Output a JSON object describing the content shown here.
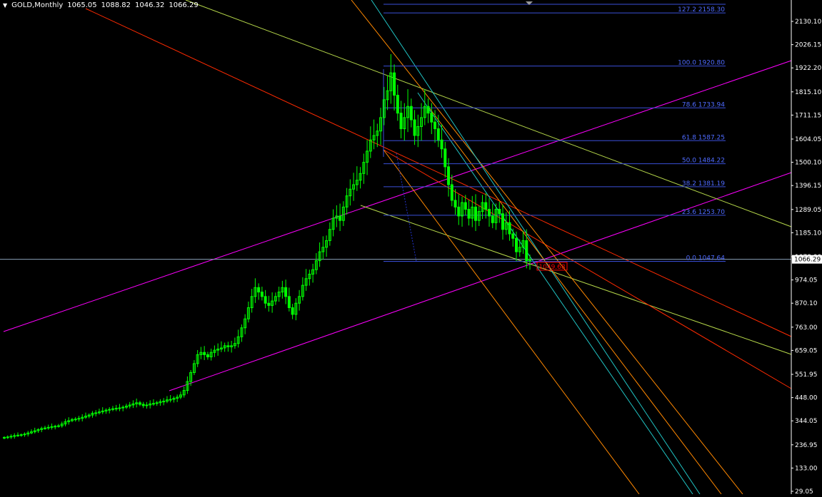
{
  "header": {
    "symbol_timeframe": "GOLD,Monthly",
    "open": "1065.05",
    "high": "1088.82",
    "low": "1046.32",
    "close": "1066.29",
    "menu_icon": "triangle-down-icon"
  },
  "colors": {
    "background": "#000000",
    "candle": "#00ff00",
    "axis_text": "#ffffff",
    "fib_line": "#3a4fd8",
    "fib_text": "#4f6bff",
    "price_label_bg": "#ffffff",
    "magenta": "#ff00ff",
    "red": "#ff2a00",
    "orange": "#ff8800",
    "yellow_green": "#b7d94a",
    "cyan": "#20c4c4",
    "crosshair": "#8aa0b8",
    "price_marker": "#ff0000"
  },
  "chart_data": {
    "type": "candlestick",
    "instrument": "GOLD",
    "timeframe": "Monthly",
    "y_axis_ticks": [
      "2130.10",
      "2026.15",
      "1922.20",
      "1815.10",
      "1711.15",
      "1604.05",
      "1500.10",
      "1396.15",
      "1289.05",
      "1185.10",
      "1078.00",
      "974.05",
      "870.10",
      "763.00",
      "659.05",
      "551.95",
      "448.00",
      "344.05",
      "236.95",
      "133.00",
      "29.05"
    ],
    "current_price_label": "1066.29",
    "ylim": [
      29.05,
      2130.1
    ],
    "fibonacci": [
      {
        "label": "127.2  2158.30",
        "level": 127.2,
        "price": 2158.3
      },
      {
        "label": "100.0  1920.80",
        "level": 100.0,
        "price": 1920.8
      },
      {
        "label": "78.6  1733.94",
        "level": 78.6,
        "price": 1733.94
      },
      {
        "label": "61.8  1587.25",
        "level": 61.8,
        "price": 1587.25
      },
      {
        "label": "50.0  1484.22",
        "level": 50.0,
        "price": 1484.22
      },
      {
        "label": "38.2  1381.19",
        "level": 38.2,
        "price": 1381.19
      },
      {
        "label": "23.6  1253.70",
        "level": 23.6,
        "price": 1253.7
      },
      {
        "label": "0.0  1047.64",
        "level": 0.0,
        "price": 1047.64
      }
    ],
    "price_marker_label": "1049.68",
    "price_series_close": [
      270,
      272,
      275,
      278,
      280,
      282,
      285,
      290,
      295,
      300,
      305,
      310,
      312,
      315,
      318,
      320,
      322,
      330,
      340,
      345,
      350,
      352,
      355,
      360,
      365,
      370,
      378,
      380,
      384,
      388,
      392,
      395,
      398,
      400,
      402,
      405,
      410,
      415,
      420,
      425,
      418,
      412,
      415,
      420,
      422,
      425,
      430,
      432,
      438,
      440,
      445,
      450,
      460,
      480,
      520,
      560,
      600,
      640,
      650,
      640,
      630,
      650,
      660,
      665,
      670,
      680,
      675,
      680,
      690,
      720,
      760,
      800,
      850,
      900,
      940,
      920,
      900,
      870,
      860,
      880,
      900,
      920,
      940,
      900,
      850,
      820,
      870,
      900,
      950,
      980,
      1000,
      1020,
      1060,
      1100,
      1120,
      1150,
      1200,
      1250,
      1260,
      1240,
      1300,
      1350,
      1380,
      1400,
      1420,
      1450,
      1500,
      1550,
      1600,
      1620,
      1640,
      1700,
      1780,
      1820,
      1900,
      1800,
      1720,
      1650,
      1700,
      1750,
      1690,
      1620,
      1660,
      1700,
      1750,
      1720,
      1680,
      1650,
      1600,
      1560,
      1480,
      1400,
      1330,
      1300,
      1260,
      1320,
      1290,
      1250,
      1300,
      1240,
      1280,
      1320,
      1290,
      1260,
      1230,
      1290,
      1270,
      1200,
      1230,
      1180,
      1160,
      1100,
      1120,
      1150,
      1060,
      1066
    ]
  }
}
